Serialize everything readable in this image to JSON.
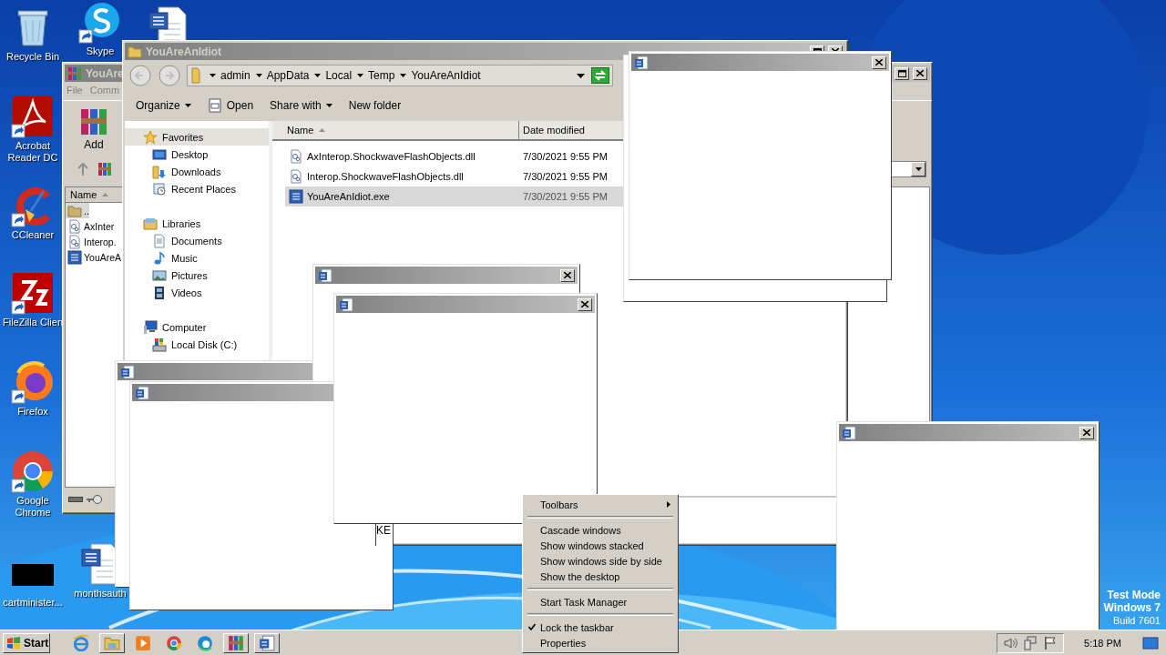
{
  "desktop_icons": [
    {
      "kind": "recycle",
      "label": "Recycle Bin",
      "shortcut": false
    },
    {
      "kind": "acrobat",
      "label": "Acrobat Reader DC",
      "shortcut": true
    },
    {
      "kind": "ccleaner",
      "label": "CCleaner",
      "shortcut": true
    },
    {
      "kind": "filezilla",
      "label": "FileZilla Clien",
      "shortcut": true
    },
    {
      "kind": "firefox",
      "label": "Firefox",
      "shortcut": true
    },
    {
      "kind": "chrome",
      "label": "Google Chrome",
      "shortcut": true
    },
    {
      "kind": "black-thumb",
      "label": "cartminister...",
      "shortcut": false
    },
    {
      "kind": "skype",
      "label": "Skype",
      "shortcut": true
    },
    {
      "kind": "word-doc",
      "label": "monthsauth",
      "shortcut": false
    },
    {
      "kind": "word-doc",
      "shortcut": false
    }
  ],
  "winrar_window": {
    "title": "YouAre",
    "menu": [
      "File",
      "Comm"
    ],
    "tools": [
      {
        "label": "Add",
        "kind": "add"
      }
    ],
    "column": {
      "label": "Name",
      "sorted": true
    },
    "rows": [
      {
        "name": "..",
        "kind": "up-folder",
        "selected": true
      },
      {
        "name": "AxInter",
        "kind": "dll",
        "selected": false
      },
      {
        "name": "Interop.",
        "kind": "dll",
        "selected": false
      },
      {
        "name": "YouAreA",
        "kind": "exe",
        "selected": false
      }
    ]
  },
  "explorer_window": {
    "title": "YouAreAnIdiot",
    "breadcrumbs": [
      "admin",
      "AppData",
      "Local",
      "Temp",
      "YouAreAnIdiot"
    ],
    "toolbar": [
      {
        "label": "Organize",
        "kind": "menu"
      },
      {
        "label": "Open",
        "kind": "open"
      },
      {
        "label": "Share with",
        "kind": "menu"
      },
      {
        "label": "New folder",
        "kind": "plain"
      }
    ],
    "nav": [
      {
        "label": "Favorites",
        "kind": "star",
        "selected": true,
        "children": [
          {
            "label": "Desktop",
            "kind": "desktop",
            "selected": false
          },
          {
            "label": "Downloads",
            "kind": "downloads",
            "selected": false
          },
          {
            "label": "Recent Places",
            "kind": "recent",
            "selected": false
          }
        ]
      },
      {
        "label": "Libraries",
        "kind": "libraries",
        "selected": false,
        "children": [
          {
            "label": "Documents",
            "kind": "documents",
            "selected": false
          },
          {
            "label": "Music",
            "kind": "music",
            "selected": false
          },
          {
            "label": "Pictures",
            "kind": "pictures",
            "selected": false
          },
          {
            "label": "Videos",
            "kind": "videos",
            "selected": false
          }
        ]
      },
      {
        "label": "Computer",
        "kind": "computer",
        "selected": false,
        "children": [
          {
            "label": "Local Disk (C:)",
            "kind": "disk",
            "selected": false
          }
        ]
      }
    ],
    "columns": [
      {
        "label": "Name",
        "sorted": true
      },
      {
        "label": "Date modified",
        "sorted": false
      }
    ],
    "files": [
      {
        "name": "AxInterop.ShockwaveFlashObjects.dll",
        "date": "7/30/2021 9:55 PM",
        "kind": "dll",
        "selected": false
      },
      {
        "name": "Interop.ShockwaveFlashObjects.dll",
        "date": "7/30/2021 9:55 PM",
        "kind": "dll",
        "selected": false
      },
      {
        "name": "YouAreAnIdiot.exe",
        "date": "7/30/2021 9:55 PM",
        "kind": "exe",
        "selected": true
      }
    ],
    "fragment_text": "KE"
  },
  "popup_windows": [
    {
      "kind": "word-popup"
    },
    {
      "kind": "word-popup",
      "close_button": true
    },
    {
      "kind": "word-popup"
    },
    {
      "kind": "word-popup",
      "close_button": true
    },
    {
      "kind": "word-popup"
    },
    {
      "kind": "word-popup",
      "close_button": true
    },
    {
      "kind": "word-popup",
      "close_button": true
    }
  ],
  "context_menu": {
    "groups": [
      [
        {
          "label": "Toolbars",
          "submenu": true,
          "checked": false
        }
      ],
      [
        {
          "label": "Cascade windows",
          "submenu": false,
          "checked": false
        },
        {
          "label": "Show windows stacked",
          "submenu": false,
          "checked": false
        },
        {
          "label": "Show windows side by side",
          "submenu": false,
          "checked": false
        },
        {
          "label": "Show the desktop",
          "submenu": false,
          "checked": false
        }
      ],
      [
        {
          "label": "Start Task Manager",
          "submenu": false,
          "checked": false
        }
      ],
      [
        {
          "label": "Lock the taskbar",
          "submenu": false,
          "checked": true
        },
        {
          "label": "Properties",
          "submenu": false,
          "checked": false
        }
      ]
    ]
  },
  "test_mode_notice": [
    "Test Mode",
    "Windows 7",
    "Build 7601"
  ],
  "taskbar": {
    "start": "Start",
    "apps": [
      {
        "kind": "ie",
        "running": false
      },
      {
        "kind": "explorer",
        "running": true
      },
      {
        "kind": "media-player",
        "running": false
      },
      {
        "kind": "chrome",
        "running": false
      },
      {
        "kind": "edge",
        "running": false
      },
      {
        "kind": "winrar",
        "running": true
      },
      {
        "kind": "word",
        "running": true
      }
    ],
    "tray": [
      {
        "kind": "volume"
      },
      {
        "kind": "network"
      },
      {
        "kind": "flag"
      }
    ],
    "clock": "5:18 PM"
  }
}
